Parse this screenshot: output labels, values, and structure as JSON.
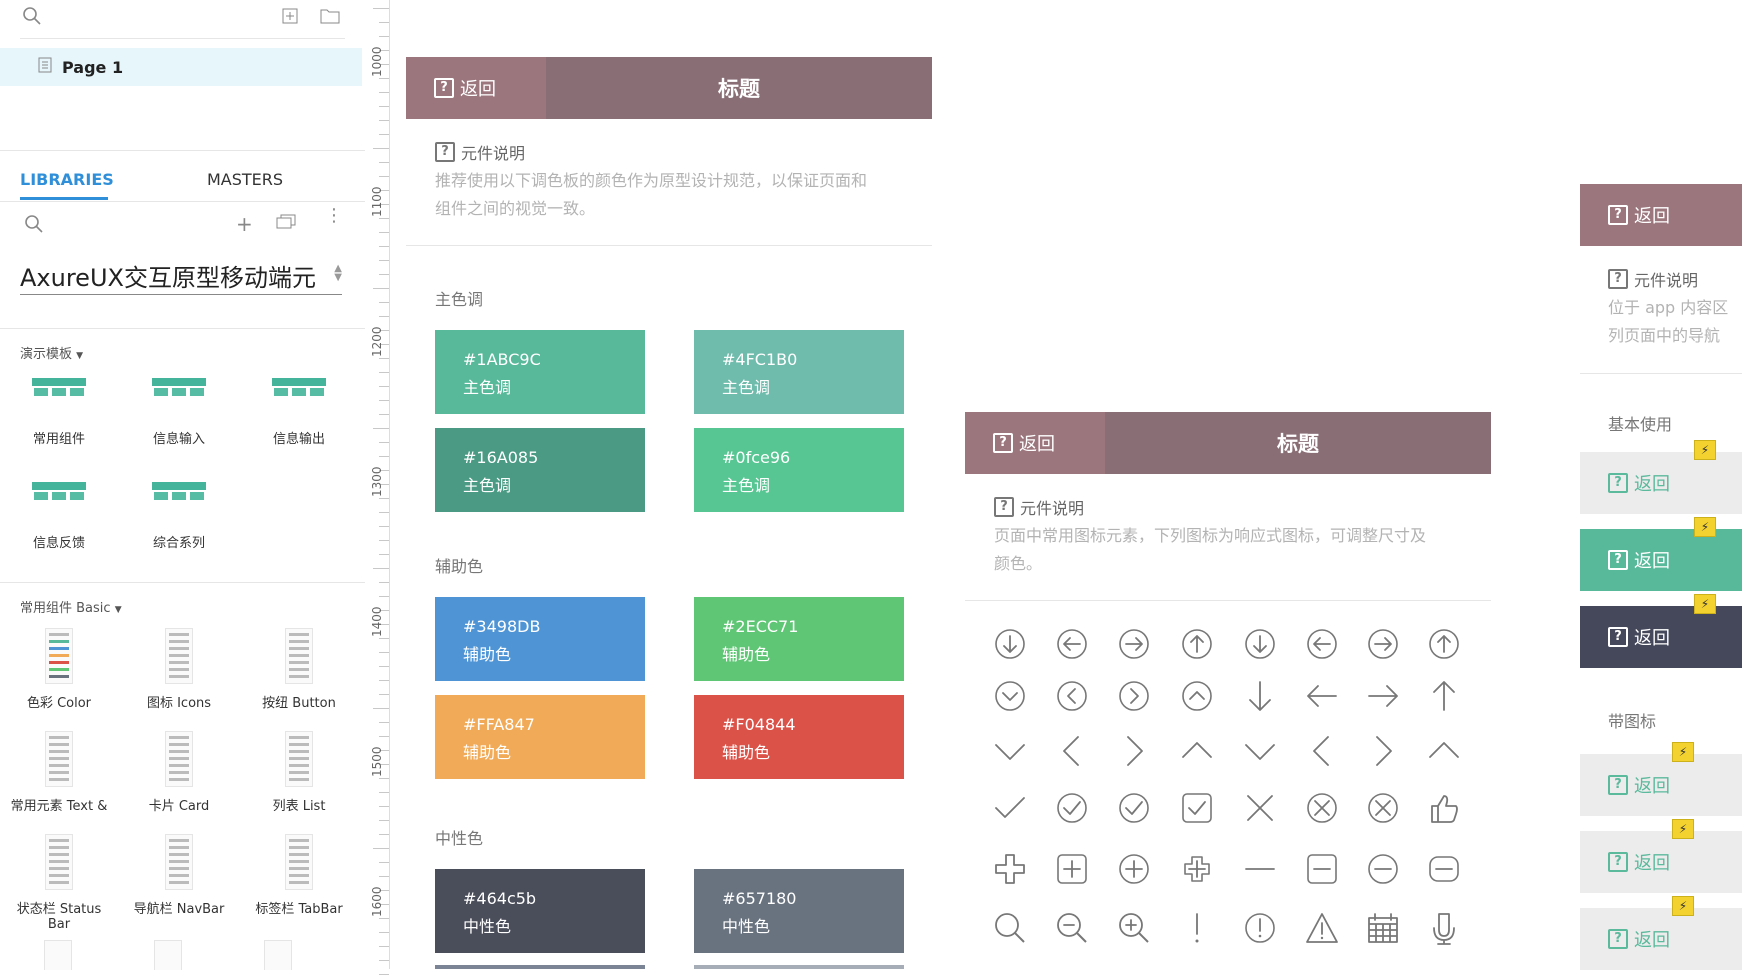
{
  "left_panel": {
    "page_item": "Page 1",
    "tabs": [
      "LIBRARIES",
      "MASTERS"
    ],
    "library_name": "AxureUX交互原型移动端元",
    "group1": {
      "title": "演示模板",
      "items": [
        "常用组件",
        "信息输入",
        "信息输出",
        "信息反馈",
        "综合系列"
      ]
    },
    "group2": {
      "title": "常用组件 Basic",
      "items": [
        "色彩 Color",
        "图标 Icons",
        "按纽 Button",
        "常用元素 Text &",
        "卡片 Card",
        "列表 List",
        "状态栏 Status Bar",
        "导航栏 NavBar",
        "标签栏 TabBar"
      ]
    }
  },
  "ruler": {
    "labels": [
      "1000",
      "1100",
      "1200",
      "1300",
      "1400",
      "1500",
      "1600"
    ]
  },
  "color_card": {
    "back_label": "返回",
    "title": "标题",
    "desc_title": "元件说明",
    "desc_lines": [
      "推荐使用以下调色板的颜色作为原型设计规范，以保证页面和",
      "组件之间的视觉一致。"
    ],
    "sections": [
      {
        "name": "主色调",
        "swatches": [
          {
            "hex": "#1ABC9C",
            "label": "主色调",
            "color": "#58b99a"
          },
          {
            "hex": "#4FC1B0",
            "label": "主色调",
            "color": "#6fbbac"
          },
          {
            "hex": "#16A085",
            "label": "主色调",
            "color": "#4b9b84"
          },
          {
            "hex": "#0fce96",
            "label": "主色调",
            "color": "#57c693"
          }
        ]
      },
      {
        "name": "辅助色",
        "swatches": [
          {
            "hex": "#3498DB",
            "label": "辅助色",
            "color": "#4f95d6"
          },
          {
            "hex": "#2ECC71",
            "label": "辅助色",
            "color": "#5fc675"
          },
          {
            "hex": "#FFA847",
            "label": "辅助色",
            "color": "#f1aa58"
          },
          {
            "hex": "#F04844",
            "label": "辅助色",
            "color": "#db5249"
          }
        ]
      },
      {
        "name": "中性色",
        "swatches": [
          {
            "hex": "#464c5b",
            "label": "中性色",
            "color": "#4a4d5a"
          },
          {
            "hex": "#657180",
            "label": "中性色",
            "color": "#697380"
          }
        ]
      }
    ]
  },
  "icon_card": {
    "back_label": "返回",
    "title": "标题",
    "desc_title": "元件说明",
    "desc_lines": [
      "页面中常用图标元素，下列图标为响应式图标，可调整尺寸及",
      "颜色。"
    ],
    "icons": [
      "circle-arrow-down-icon",
      "circle-arrow-left-icon",
      "circle-arrow-right-icon",
      "circle-arrow-up-icon",
      "circle-arrow-down-alt-icon",
      "circle-arrow-left-alt-icon",
      "circle-arrow-right-alt-icon",
      "circle-arrow-up-alt-icon",
      "circle-chevron-down-icon",
      "circle-chevron-left-icon",
      "circle-chevron-right-icon",
      "circle-chevron-up-icon",
      "arrow-down-icon",
      "arrow-left-icon",
      "arrow-right-icon",
      "arrow-up-icon",
      "chevron-down-icon",
      "chevron-left-icon",
      "chevron-right-icon",
      "chevron-up-icon",
      "chevron-down-alt-icon",
      "chevron-left-alt-icon",
      "chevron-right-alt-icon",
      "chevron-up-alt-icon",
      "check-icon",
      "circle-check-icon",
      "circle-check-alt-icon",
      "square-check-icon",
      "close-icon",
      "circle-close-icon",
      "circle-close-alt-icon",
      "thumbs-up-icon",
      "plus-icon",
      "square-plus-icon",
      "circle-plus-icon",
      "cross-plus-icon",
      "minus-icon",
      "square-minus-icon",
      "circle-minus-icon",
      "rounded-minus-icon",
      "search-icon",
      "zoom-out-icon",
      "zoom-in-icon",
      "exclamation-icon",
      "circle-exclamation-icon",
      "warning-icon",
      "calendar-icon",
      "microphone-icon"
    ]
  },
  "right_card": {
    "back_label": "返回",
    "desc_title": "元件说明",
    "desc_lines": [
      "位于 app 内容区",
      "列页面中的导航"
    ],
    "section1": "基本使用",
    "section2": "带图标",
    "buttons": [
      "返回",
      "返回",
      "返回",
      "返回",
      "返回",
      "返回"
    ]
  }
}
